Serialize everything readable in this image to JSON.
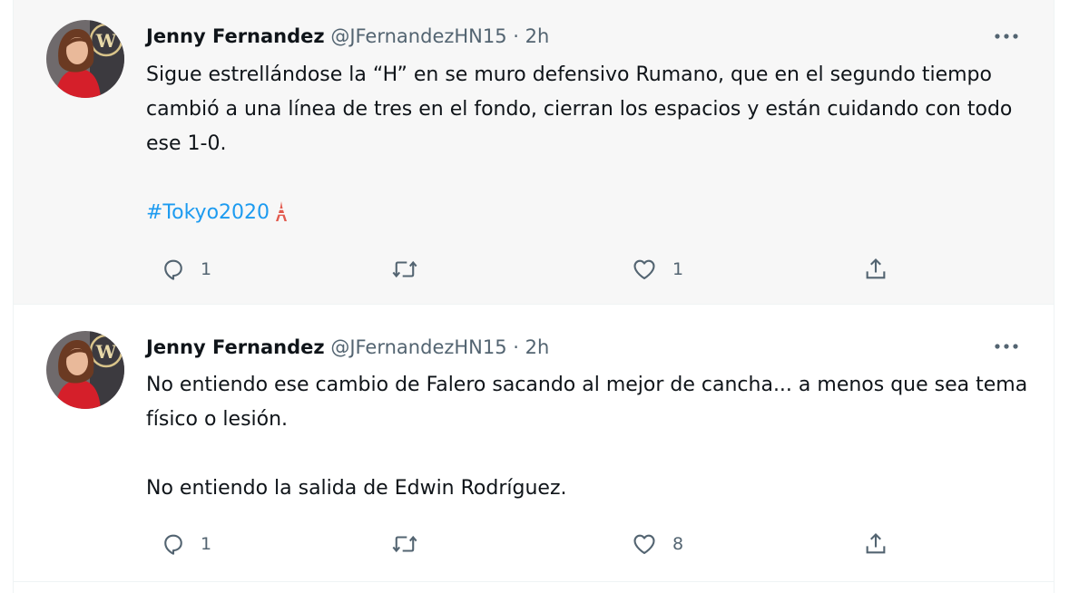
{
  "tweets": [
    {
      "author": {
        "name": "Jenny Fernandez",
        "handle": "@JFernandezHN15",
        "separator": "·",
        "time": "2h"
      },
      "paragraphs": [
        "Sigue estrellándose la “H” en se muro defensivo Rumano, que en el segundo tiempo cambió a una línea de tres en el fondo, cierran los espacios y están cuidando con todo ese 1-0."
      ],
      "hashtag": "#Tokyo2020",
      "hashtag_emoji": "tokyo-tower-icon",
      "actions": {
        "replies": "1",
        "retweets": "",
        "likes": "1"
      }
    },
    {
      "author": {
        "name": "Jenny Fernandez",
        "handle": "@JFernandezHN15",
        "separator": "·",
        "time": "2h"
      },
      "paragraphs": [
        "No entiendo ese cambio de Falero sacando al mejor de cancha... a menos que sea tema físico o lesión.",
        "No entiendo la salida de Edwin Rodríguez."
      ],
      "actions": {
        "replies": "1",
        "retweets": "",
        "likes": "8"
      }
    }
  ],
  "icons": {
    "more": "more-dots-icon",
    "reply": "reply-icon",
    "retweet": "retweet-icon",
    "like": "heart-icon",
    "share": "share-icon"
  },
  "colors": {
    "text": "#0f1419",
    "secondary": "#536471",
    "link": "#1d9bf0",
    "highlight_bg": "#f7f7f7",
    "border": "#eff3f4"
  }
}
